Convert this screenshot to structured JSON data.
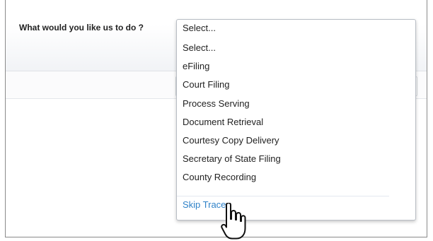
{
  "form": {
    "question": "What would you like us to do ?"
  },
  "dropdown": {
    "current": "Select...",
    "options": [
      "Select...",
      "eFiling",
      "Court Filing",
      "Process Serving",
      "Document Retrieval",
      "Courtesy Copy Delivery",
      "Secretary of State Filing",
      "County Recording",
      "Skip Trace"
    ],
    "highlighted": "Skip Trace"
  },
  "colors": {
    "highlight_text": "#2f82c8",
    "text": "#222222"
  },
  "icons": {
    "cursor": "hand-pointer-icon"
  }
}
